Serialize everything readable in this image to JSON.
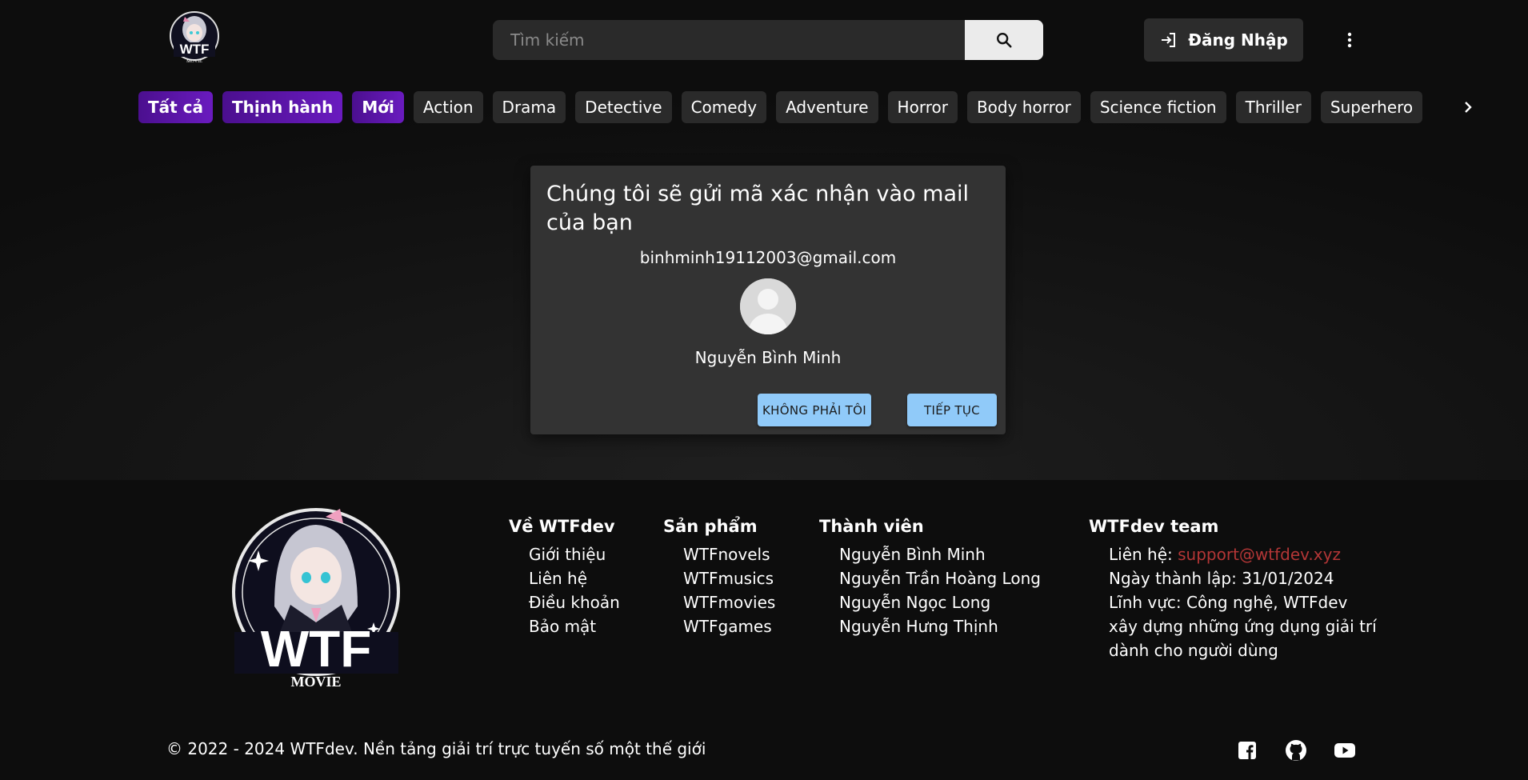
{
  "header": {
    "logo_text": "WTF",
    "logo_sub": "MOVIE",
    "search": {
      "placeholder": "Tìm kiếm"
    },
    "login_label": "Đăng Nhập"
  },
  "genres": {
    "items": [
      {
        "label": "Tất cả",
        "highlight": true
      },
      {
        "label": "Thịnh hành",
        "highlight": true
      },
      {
        "label": "Mới",
        "highlight": true
      },
      {
        "label": "Action"
      },
      {
        "label": "Drama"
      },
      {
        "label": "Detective"
      },
      {
        "label": "Comedy"
      },
      {
        "label": "Adventure"
      },
      {
        "label": "Horror"
      },
      {
        "label": "Body horror"
      },
      {
        "label": "Science fiction"
      },
      {
        "label": "Thriller"
      },
      {
        "label": "Superhero"
      }
    ],
    "next_icon": "chevron-right-icon"
  },
  "dialog": {
    "title": "Chúng tôi sẽ gửi mã xác nhận vào mail của bạn",
    "email": "binhminh19112003@gmail.com",
    "avatar_icon": "default-user-avatar",
    "name": "Nguyễn Bình Minh",
    "not_me_label": "KHÔNG PHẢI TÔI",
    "continue_label": "TIẾP TỤC"
  },
  "footer": {
    "logo_text": "WTF",
    "logo_sub": "MOVIE",
    "columns": [
      {
        "title": "Về WTFdev",
        "items": [
          "Giới thiệu",
          "Liên hệ",
          "Điều khoản",
          "Bảo mật"
        ]
      },
      {
        "title": "Sản phẩm",
        "items": [
          "WTFnovels",
          "WTFmusics",
          "WTFmovies",
          "WTFgames"
        ]
      },
      {
        "title": "Thành viên",
        "items": [
          "Nguyễn Bình Minh",
          "Nguyễn Trần Hoàng Long",
          "Nguyễn Ngọc Long",
          "Nguyễn Hưng Thịnh"
        ]
      }
    ],
    "team": {
      "title": "WTFdev team",
      "contact_label": "Liên hệ: ",
      "contact_email": "support@wtfdev.xyz",
      "founded": "Ngày thành lập: 31/01/2024",
      "field": "Lĩnh vực: Công nghệ, WTFdev xây dựng những ứng dụng giải trí dành cho người dùng"
    },
    "copyright": "© 2022 - 2024 WTFdev. Nền tảng giải trí trực tuyến số một thế giới",
    "social": [
      "facebook-icon",
      "github-icon",
      "youtube-icon"
    ]
  },
  "colors": {
    "background": "#0d0d0d",
    "chip": "#2a2a2a",
    "chip_highlight": "#5a16aa",
    "dialog": "#333333",
    "dialog_button": "#90caf9",
    "contact_link": "#b33636"
  }
}
